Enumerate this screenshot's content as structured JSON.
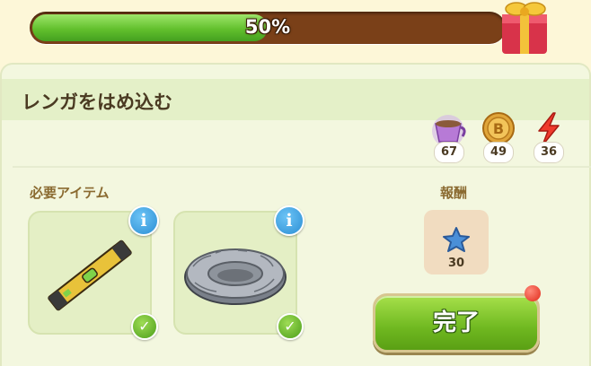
{
  "progress": {
    "percent_label": "50%",
    "value": 0.5
  },
  "quest": {
    "title": "レンガをはめ込む"
  },
  "resources": [
    {
      "icon": "tea-cup-icon",
      "count": "67"
    },
    {
      "icon": "coin-icon",
      "count": "49"
    },
    {
      "icon": "energy-bolt-icon",
      "count": "36"
    }
  ],
  "required": {
    "label": "必要アイテム",
    "items": [
      {
        "icon": "spirit-level-icon",
        "info": "i"
      },
      {
        "icon": "stone-ring-icon",
        "info": "i"
      }
    ]
  },
  "reward": {
    "label": "報酬",
    "icon": "blue-star-icon",
    "count": "30"
  },
  "done_button": {
    "label": "完了"
  }
}
